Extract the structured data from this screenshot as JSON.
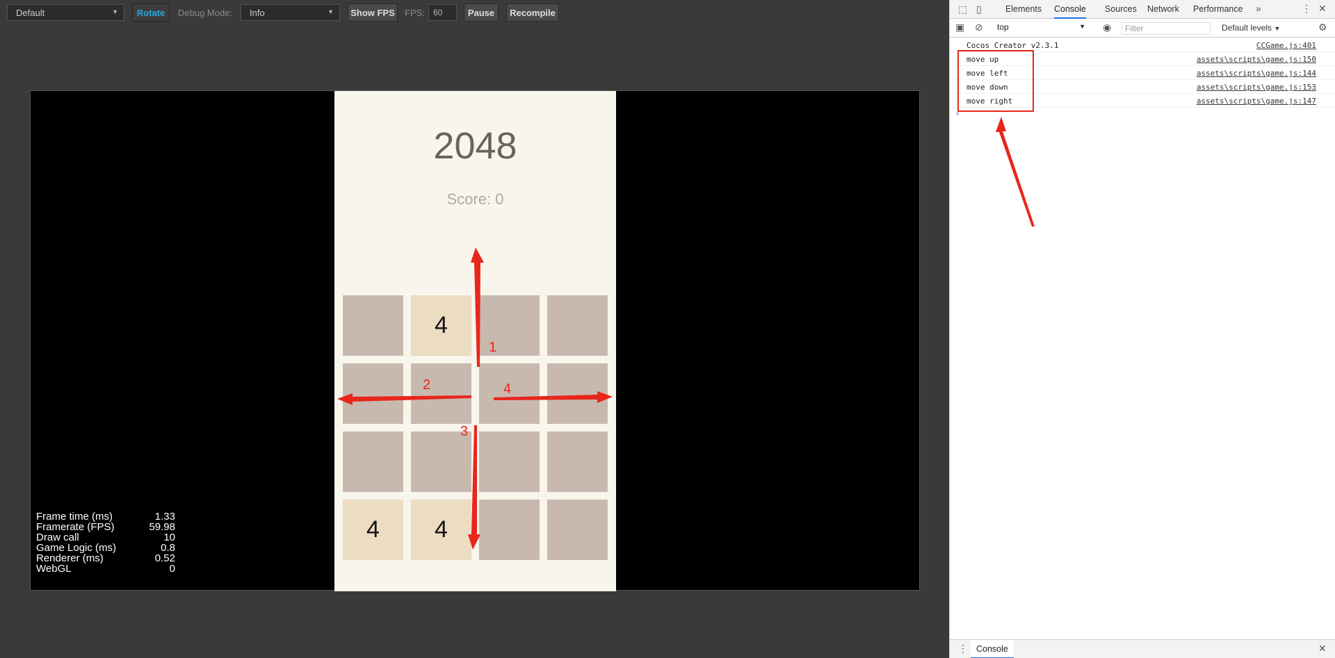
{
  "toolbar": {
    "device_select": "Default",
    "rotate_label": "Rotate",
    "debug_mode_label": "Debug Mode:",
    "debug_mode_value": "Info",
    "show_fps_label": "Show FPS",
    "fps_label": "FPS:",
    "fps_value": "60",
    "pause_label": "Pause",
    "recompile_label": "Recompile"
  },
  "game": {
    "title": "2048",
    "score_label": "Score: 0",
    "board": [
      [
        "",
        "4",
        "",
        ""
      ],
      [
        "",
        "",
        "",
        ""
      ],
      [
        "",
        "",
        "",
        ""
      ],
      [
        "4",
        "4",
        "",
        ""
      ]
    ],
    "annotations": [
      "1",
      "2",
      "3",
      "4"
    ]
  },
  "stats": [
    {
      "label": "Frame time (ms)",
      "value": "1.33"
    },
    {
      "label": "Framerate (FPS)",
      "value": "59.98"
    },
    {
      "label": "Draw call",
      "value": "10"
    },
    {
      "label": "Game Logic (ms)",
      "value": "0.8"
    },
    {
      "label": "Renderer (ms)",
      "value": "0.52"
    },
    {
      "label": "WebGL",
      "value": "0"
    }
  ],
  "devtools": {
    "tabs": [
      "Elements",
      "Console",
      "Sources",
      "Network",
      "Performance"
    ],
    "active_tab": "Console",
    "more_tabs_icon": "double-chevron-right-icon",
    "context": "top",
    "filter_placeholder": "Filter",
    "levels": "Default levels",
    "console": [
      {
        "message": "Cocos Creator v2.3.1",
        "source": "CCGame.js:401"
      },
      {
        "message": "move up",
        "source": "assets\\scripts\\game.js:150"
      },
      {
        "message": "move left",
        "source": "assets\\scripts\\game.js:144"
      },
      {
        "message": "move down",
        "source": "assets\\scripts\\game.js:153"
      },
      {
        "message": "move right",
        "source": "assets\\scripts\\game.js:147"
      }
    ],
    "prompt": "›",
    "drawer_tab": "Console"
  },
  "colors": {
    "accent_blue": "#27a7e6",
    "annotation_red": "#e8261c",
    "tile_empty": "#c8b9ae",
    "tile_filled": "#ecdcc2",
    "game_bg": "#f8f5ec"
  }
}
